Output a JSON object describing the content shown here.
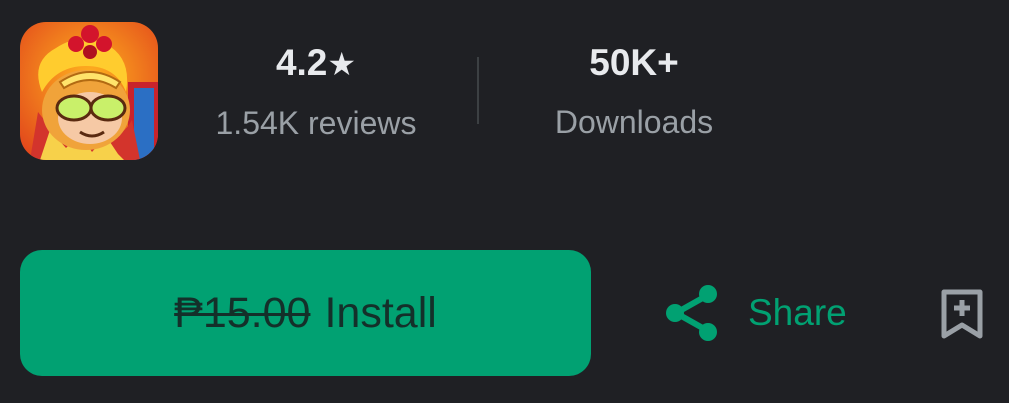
{
  "app": {
    "icon_name": "monkey-king-app-icon"
  },
  "stats": {
    "rating": "4.2",
    "rating_star": "★",
    "reviews": "1.54K reviews",
    "downloads_value": "50K+",
    "downloads_label": "Downloads"
  },
  "actions": {
    "old_price": "₱15.00",
    "install_label": "Install",
    "share_label": "Share",
    "share_icon": "share-icon",
    "wishlist_icon": "bookmark-add-icon"
  },
  "colors": {
    "background": "#1f2024",
    "accent": "#01a172",
    "text_primary": "#e8eaed",
    "text_secondary": "#9aa0a6"
  }
}
